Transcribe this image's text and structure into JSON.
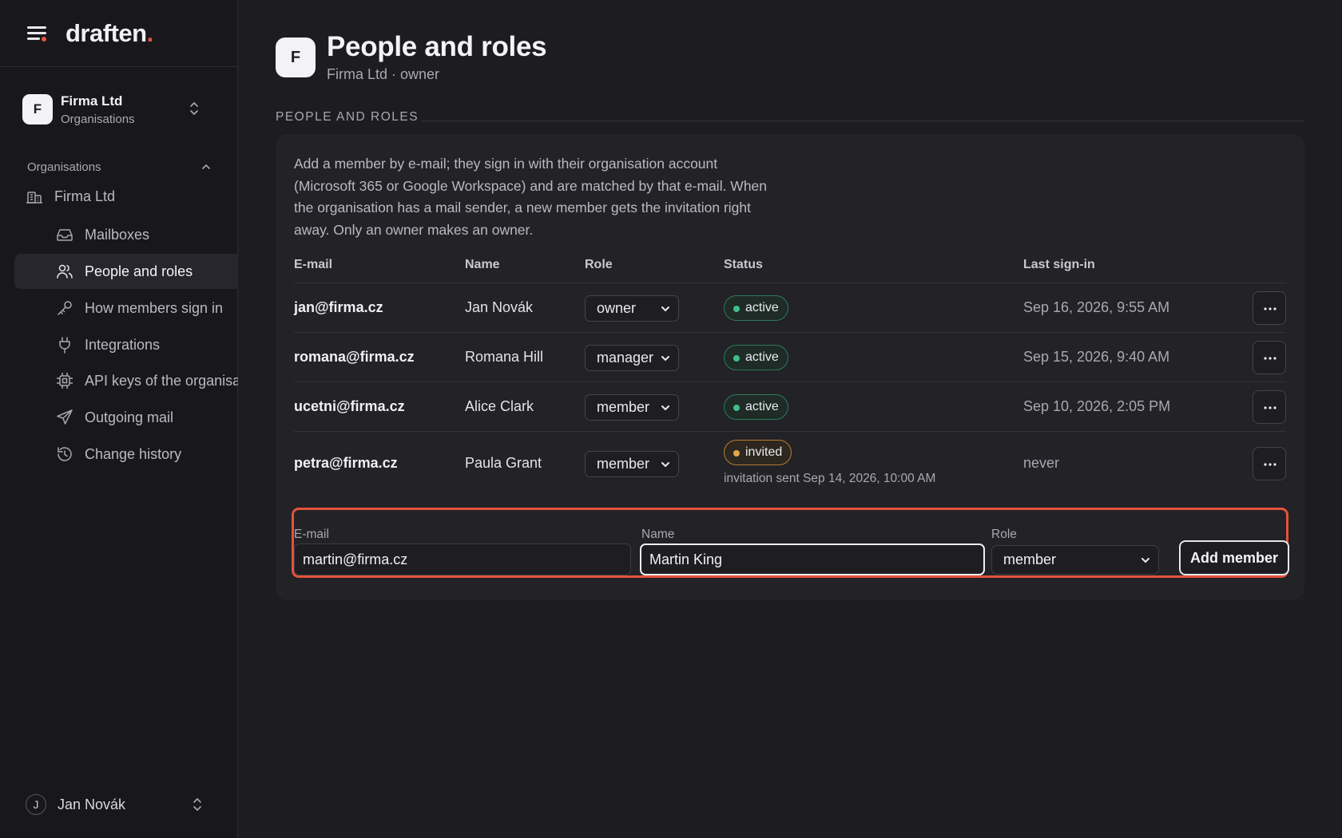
{
  "brand": {
    "logo_text": "draften",
    "logo_dot": ".",
    "accent": "#e5533b"
  },
  "org_switcher": {
    "avatar": "F",
    "name": "Firma Ltd",
    "subtitle": "Organisations"
  },
  "sidebar": {
    "group_label": "Organisations",
    "org_item": "Firma Ltd",
    "items": [
      {
        "label": "Mailboxes",
        "icon": "inbox-icon"
      },
      {
        "label": "People and roles",
        "icon": "users-icon",
        "active": true
      },
      {
        "label": "How members sign in",
        "icon": "key-icon"
      },
      {
        "label": "Integrations",
        "icon": "plug-icon"
      },
      {
        "label": "API keys of the organisation",
        "icon": "chip-icon"
      },
      {
        "label": "Outgoing mail",
        "icon": "send-icon"
      },
      {
        "label": "Change history",
        "icon": "history-icon"
      }
    ],
    "user": {
      "avatar": "J",
      "name": "Jan Novák"
    }
  },
  "header": {
    "avatar": "F",
    "title": "People and roles",
    "subtitle": "Firma Ltd · owner"
  },
  "section": {
    "label": "PEOPLE AND ROLES",
    "intro": "Add a member by e-mail; they sign in with their organisation account (Microsoft 365 or Google Workspace) and are matched by that e-mail. When the organisation has a mail sender, a new member gets the invitation right away. Only an owner makes an owner."
  },
  "table": {
    "headers": {
      "email": "E-mail",
      "name": "Name",
      "role": "Role",
      "status": "Status",
      "last": "Last sign-in"
    },
    "rows": [
      {
        "email": "jan@firma.cz",
        "name": "Jan Novák",
        "role": "owner",
        "status": "active",
        "last": "Sep 16, 2026, 9:55 AM"
      },
      {
        "email": "romana@firma.cz",
        "name": "Romana Hill",
        "role": "manager",
        "status": "active",
        "last": "Sep 15, 2026, 9:40 AM"
      },
      {
        "email": "ucetni@firma.cz",
        "name": "Alice Clark",
        "role": "member",
        "status": "active",
        "last": "Sep 10, 2026, 2:05 PM"
      },
      {
        "email": "petra@firma.cz",
        "name": "Paula Grant",
        "role": "member",
        "status": "invited",
        "note": "invitation sent Sep 14, 2026, 10:00 AM",
        "last": "never"
      }
    ]
  },
  "add_form": {
    "email_label": "E-mail",
    "email_value": "martin@firma.cz",
    "name_label": "Name",
    "name_value": "Martin King",
    "role_label": "Role",
    "role_value": "member",
    "button": "Add member"
  },
  "colors": {
    "background": "#1c1c21",
    "sidebar": "#18181c",
    "card": "#222227",
    "active_badge": "#3fbf87",
    "invited_badge": "#e4a64a",
    "highlight": "#e5533b"
  }
}
